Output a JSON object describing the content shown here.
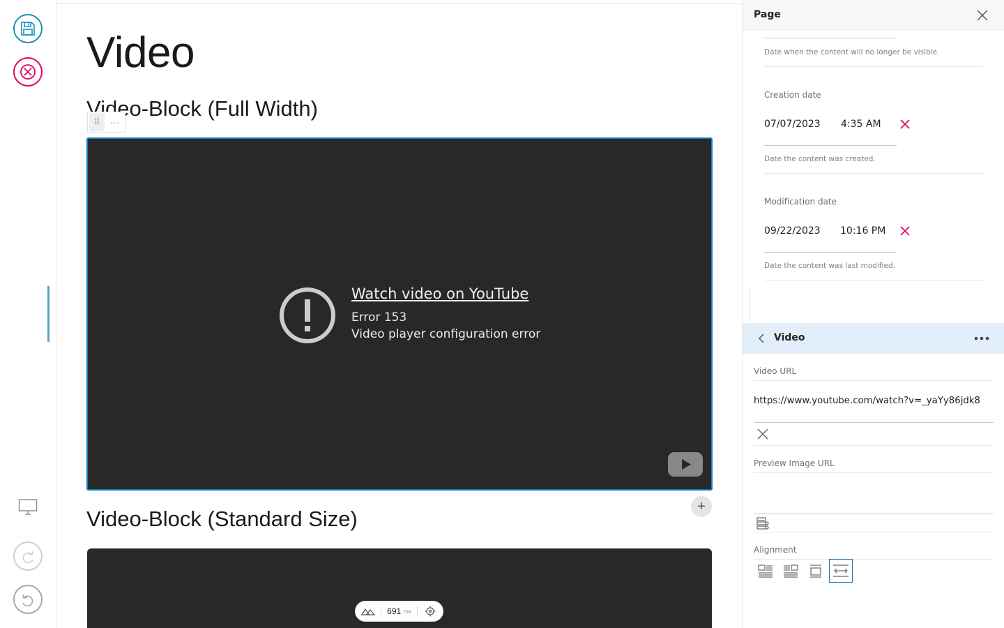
{
  "toolbar": {
    "save_icon": "floppy-disk-icon",
    "cancel_icon": "close-icon",
    "preview_icon": "monitor-icon",
    "redo_icon": "redo-icon",
    "undo_icon": "undo-icon",
    "colors": {
      "save": "#1f8fb8",
      "cancel": "#e40166"
    }
  },
  "content": {
    "page_title": "Video",
    "block1_heading": "Video-Block (Full Width)",
    "block2_heading": "Video-Block (Standard Size)",
    "embed": {
      "link_text": "Watch video on YouTube",
      "error_code": "Error 153",
      "error_message": "Video player configuration error"
    },
    "add_block_label": "+",
    "perf": {
      "value": "691",
      "unit": "ms"
    }
  },
  "sidebar": {
    "title": "Page",
    "expiration": {
      "help": "Date when the content will no longer be visible."
    },
    "creation": {
      "label": "Creation date",
      "date": "07/07/2023",
      "time": "4:35 AM",
      "help": "Date the content was created."
    },
    "modification": {
      "label": "Modification date",
      "date": "09/22/2023",
      "time": "10:16 PM",
      "help": "Date the content was last modified."
    },
    "block": {
      "title": "Video",
      "video_url_label": "Video URL",
      "video_url_value": "https://www.youtube.com/watch?v=_yaYy86jdk8",
      "preview_label": "Preview Image URL",
      "preview_value": "",
      "alignment_label": "Alignment",
      "alignment_options": [
        "left",
        "right",
        "center",
        "full"
      ],
      "alignment_selected": "full"
    }
  }
}
